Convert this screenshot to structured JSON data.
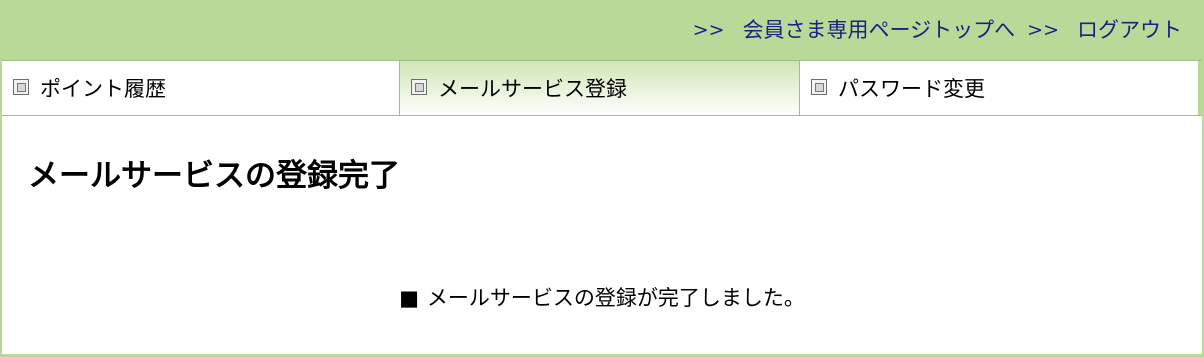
{
  "header": {
    "arrow1": ">>",
    "link_members_top": "会員さま専用ページトップへ",
    "arrow2": ">>",
    "link_logout": "ログアウト",
    "background_color": "#b8d997",
    "link_color": "#1a237e"
  },
  "tabs": [
    {
      "label": "ポイント履歴",
      "icon": "window-icon",
      "active": false
    },
    {
      "label": "メールサービス登録",
      "icon": "window-icon",
      "active": true
    },
    {
      "label": "パスワード変更",
      "icon": "window-icon",
      "active": false
    }
  ],
  "main": {
    "title": "メールサービスの登録完了",
    "message_bullet": "■",
    "message": "メールサービスの登録が完了しました。"
  }
}
